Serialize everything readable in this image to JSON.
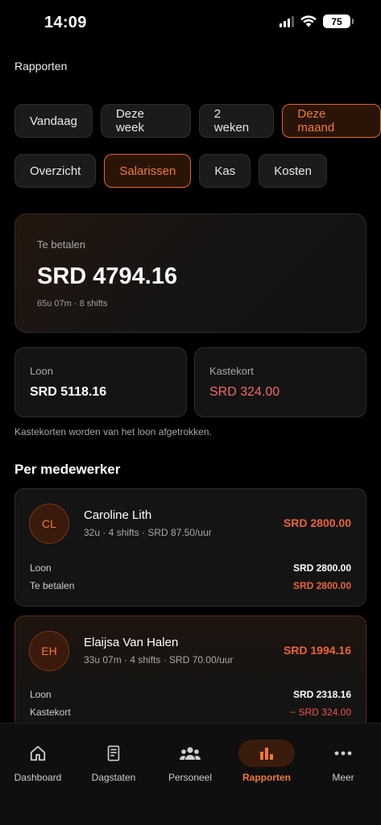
{
  "status": {
    "time": "14:09",
    "battery": "75"
  },
  "page": {
    "title": "Rapporten"
  },
  "period_filters": [
    {
      "label": "Vandaag",
      "active": false
    },
    {
      "label": "Deze week",
      "active": false
    },
    {
      "label": "2 weken",
      "active": false
    },
    {
      "label": "Deze maand",
      "active": true
    }
  ],
  "report_tabs": [
    {
      "label": "Overzicht",
      "active": false
    },
    {
      "label": "Salarissen",
      "active": true
    },
    {
      "label": "Kas",
      "active": false
    },
    {
      "label": "Kosten",
      "active": false
    }
  ],
  "summary": {
    "label": "Te betalen",
    "amount": "SRD 4794.16",
    "sub": "65u 07m · 8 shifts"
  },
  "loon": {
    "label": "Loon",
    "value": "SRD 5118.16"
  },
  "kastekort": {
    "label": "Kastekort",
    "value": "SRD 324.00"
  },
  "note": "Kastekorten worden van het loon afgetrokken.",
  "section_title": "Per medewerker",
  "employees": [
    {
      "initials": "CL",
      "name": "Caroline Lith",
      "meta": "32u · 4 shifts · SRD 87.50/uur",
      "total": "SRD 2800.00",
      "rows": [
        {
          "label": "Loon",
          "value": "SRD 2800.00"
        },
        {
          "label": "Te betalen",
          "value": "SRD 2800.00"
        }
      ]
    },
    {
      "initials": "EH",
      "name": "Elaijsa Van Halen",
      "meta": "33u 07m · 4 shifts · SRD 70.00/uur",
      "total": "SRD 1994.16",
      "rows": [
        {
          "label": "Loon",
          "value": "SRD 2318.16"
        },
        {
          "label": "Kastekort",
          "value": "− SRD 324.00"
        }
      ]
    }
  ],
  "nav": [
    {
      "label": "Dashboard",
      "icon": "home-icon",
      "active": false
    },
    {
      "label": "Dagstaten",
      "icon": "receipt-icon",
      "active": false
    },
    {
      "label": "Personeel",
      "icon": "people-icon",
      "active": false
    },
    {
      "label": "Rapporten",
      "icon": "bar-chart-icon",
      "active": true
    },
    {
      "label": "Meer",
      "icon": "more-icon",
      "active": false
    }
  ],
  "colors": {
    "accent": "#f07a3a",
    "negative": "#f06a6a",
    "background": "#000000",
    "card": "#141414"
  }
}
